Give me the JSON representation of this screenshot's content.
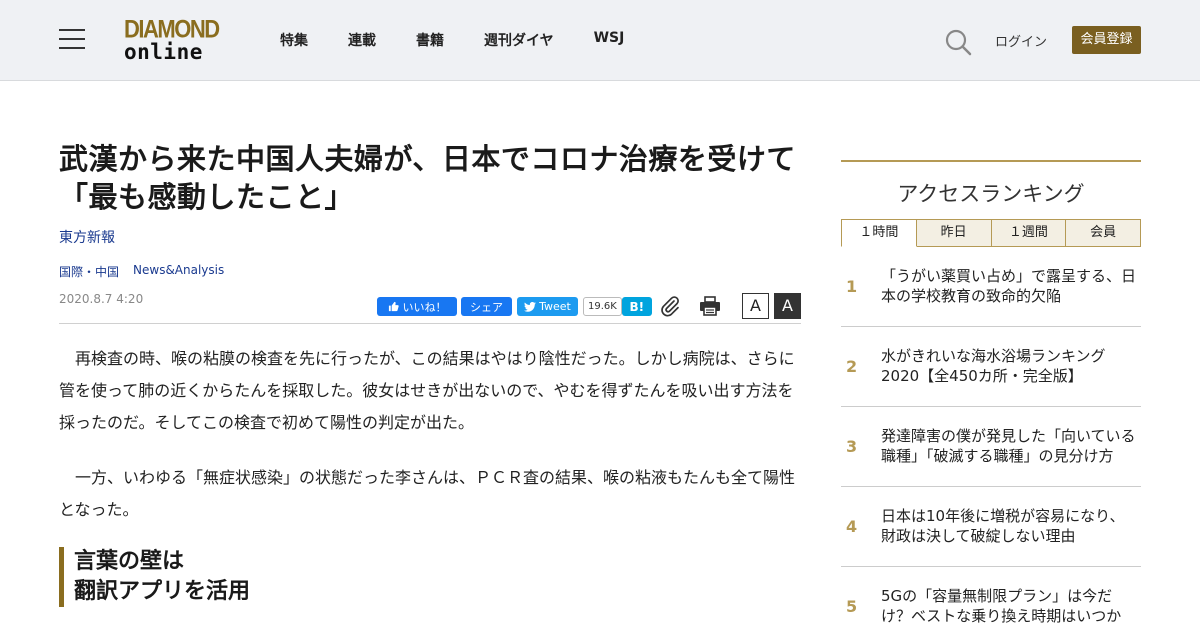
{
  "header": {
    "logo_line1": "DIAMOND",
    "logo_line2": "online",
    "nav": [
      "特集",
      "連載",
      "書籍",
      "週刊ダイヤ",
      "WSJ"
    ],
    "login": "ログイン",
    "register": "会員登録",
    "brand_color": "#7a5f20"
  },
  "article": {
    "title": "武漢から来た中国人夫婦が、日本でコロナ治療を受けて「最も感動したこと」",
    "source": "東方新報",
    "categories": [
      "国際・中国",
      "News&Analysis"
    ],
    "date": "2020.8.7 4:20",
    "share": {
      "fb_like": "いいね！",
      "fb_share": "シェア",
      "tweet": "Tweet",
      "hatena_count": "19.6K",
      "hatena_label": "B!"
    },
    "font_small": "A",
    "font_large": "A",
    "paragraphs": [
      "再検査の時、喉の粘膜の検査を先に行ったが、この結果はやはり陰性だった。しかし病院は、さらに管を使って肺の近くからたんを採取した。彼女はせきが出ないので、やむを得ずたんを吸い出す方法を採ったのだ。そしてこの検査で初めて陽性の判定が出た。",
      "一方、いわゆる「無症状感染」の状態だった李さんは、ＰＣＲ査の結果、喉の粘液もたんも全て陽性となった。"
    ],
    "subhead_line1": "言葉の壁は",
    "subhead_line2": "翻訳アプリを活用"
  },
  "sidebar": {
    "ranking_title": "アクセスランキング",
    "tabs": [
      "１時間",
      "昨日",
      "１週間",
      "会員"
    ],
    "items": [
      {
        "rank": "1",
        "text": "「うがい薬買い占め」で露呈する、日本の学校教育の致命的欠陥"
      },
      {
        "rank": "2",
        "text": "水がきれいな海水浴場ランキング2020【全450カ所・完全版】"
      },
      {
        "rank": "3",
        "text": "発達障害の僕が発見した「向いている職種」「破滅する職種」の見分け方"
      },
      {
        "rank": "4",
        "text": "日本は10年後に増税が容易になり、財政は決して破綻しない理由"
      },
      {
        "rank": "5",
        "text": "5Gの「容量無制限プラン」は今だけ？ベストな乗り換え時期はいつか"
      }
    ]
  }
}
